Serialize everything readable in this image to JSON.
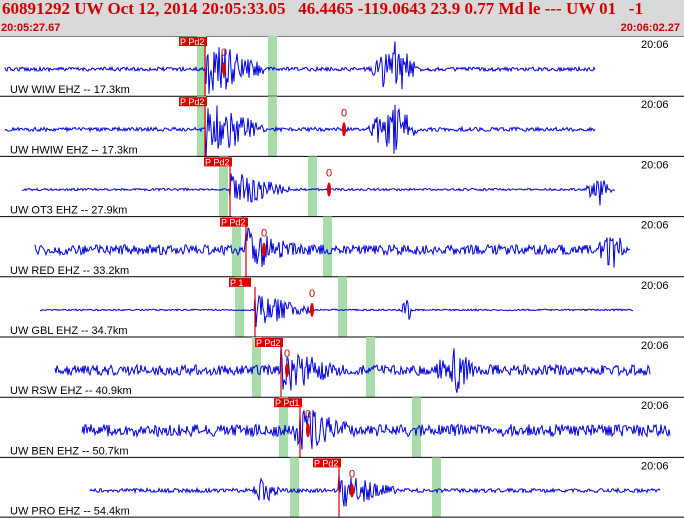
{
  "header": {
    "title": "60891292 UW Oct 12, 2014 20:05:33.05   46.4465 -119.0643 23.9 0.77 Md le --- UW 01   -1",
    "start_time": "20:05:27.67",
    "end_time": "20:06:02.27"
  },
  "colors": {
    "header_bg": "#d9d9d9",
    "header_text": "#cc0000",
    "trace": "#0000dd",
    "pick": "#dd0000",
    "window": "#a8dca8"
  },
  "chart_data": {
    "type": "line",
    "x_range_seconds_after_start": [
      0,
      34.6
    ],
    "time_tick_label": "20:06",
    "traces": [
      {
        "label": "UW WIW EHZ -- 17.3km",
        "p_pick_label": "P Pd2",
        "s_pick_label": "0",
        "amp": 0.18,
        "burst_amp": 1.0
      },
      {
        "label": "UW HWIW EHZ -- 17.3km",
        "p_pick_label": "P Pd2",
        "s_pick_label": "0",
        "amp": 0.18,
        "burst_amp": 0.95
      },
      {
        "label": "UW OT3 EHZ -- 27.9km",
        "p_pick_label": "P Pd2",
        "s_pick_label": "0",
        "amp": 0.12,
        "burst_amp": 0.7
      },
      {
        "label": "UW RED EHZ -- 33.2km",
        "p_pick_label": "P Pd2",
        "s_pick_label": "0",
        "amp": 0.5,
        "burst_amp": 0.8
      },
      {
        "label": "UW GBL EHZ -- 34.7km",
        "p_pick_label": "P 1",
        "s_pick_label": "0",
        "amp": 0.08,
        "burst_amp": 0.6
      },
      {
        "label": "UW RSW EHZ -- 40.9km",
        "p_pick_label": "P Pd2",
        "s_pick_label": "0",
        "amp": 0.6,
        "burst_amp": 1.0
      },
      {
        "label": "UW BEN EHZ -- 50.7km",
        "p_pick_label": "P Pd1",
        "s_pick_label": "0",
        "amp": 0.75,
        "burst_amp": 1.0
      },
      {
        "label": "UW PRO EHZ -- 54.4km",
        "p_pick_label": "P Pd2",
        "s_pick_label": "0",
        "amp": 0.25,
        "burst_amp": 0.8
      }
    ]
  }
}
